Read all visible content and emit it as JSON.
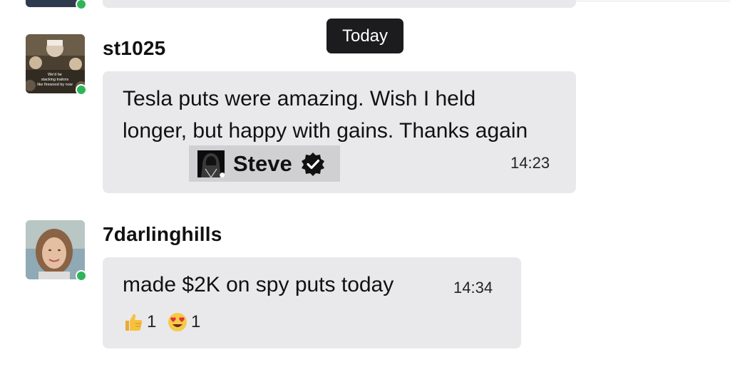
{
  "date_divider": "Today",
  "messages": [
    {
      "author": "st1025",
      "avatar_caption": "We'd be stacking traitors like firewood by now",
      "text": "Tesla puts were amazing. Wish I held longer, but happy with gains. Thanks again",
      "mention": {
        "name": "Steve",
        "verified": true,
        "icon": "verified-badge-icon"
      },
      "time": "14:23",
      "online": true
    },
    {
      "author": "7darlinghills",
      "text": "made $2K on spy puts today",
      "time": "14:34",
      "online": true,
      "reactions": [
        {
          "icon": "thumbs-up-icon",
          "count": "1"
        },
        {
          "icon": "heart-eyes-icon",
          "count": "1"
        }
      ]
    }
  ],
  "colors": {
    "bubble": "#e9e9eb",
    "mention_bg": "#d0d0d3",
    "online": "#2fb45a",
    "date_pill": "#1c1c1e"
  }
}
